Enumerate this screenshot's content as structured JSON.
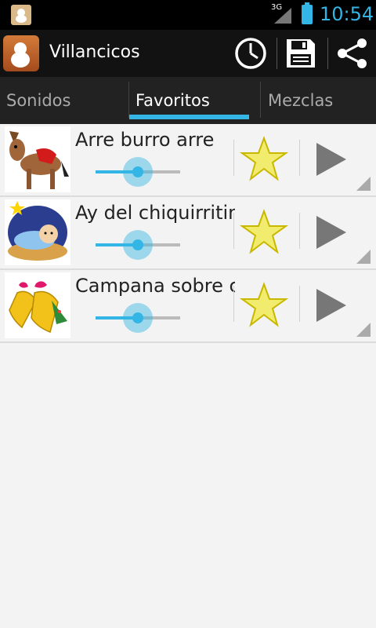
{
  "status_bar": {
    "network": "3G",
    "time": "10:54"
  },
  "app": {
    "title": "Villancicos"
  },
  "action_icons": [
    "history-icon",
    "save-icon",
    "share-icon"
  ],
  "tabs": [
    {
      "label": "Sonidos",
      "active": false
    },
    {
      "label": "Favoritos",
      "active": true
    },
    {
      "label": "Mezclas",
      "active": false
    }
  ],
  "items": [
    {
      "title": "Arre burro arre",
      "thumbnail": "donkey-icon",
      "volume": 0.5,
      "favorite": true
    },
    {
      "title": "Ay del chiquirritin",
      "thumbnail": "nativity-icon",
      "volume": 0.5,
      "favorite": true
    },
    {
      "title": "Campana sobre campana",
      "thumbnail": "bells-icon",
      "volume": 0.5,
      "favorite": true
    }
  ],
  "colors": {
    "accent": "#33b5e5",
    "star": "#f2ec6e",
    "star_outline": "#c9b800"
  }
}
